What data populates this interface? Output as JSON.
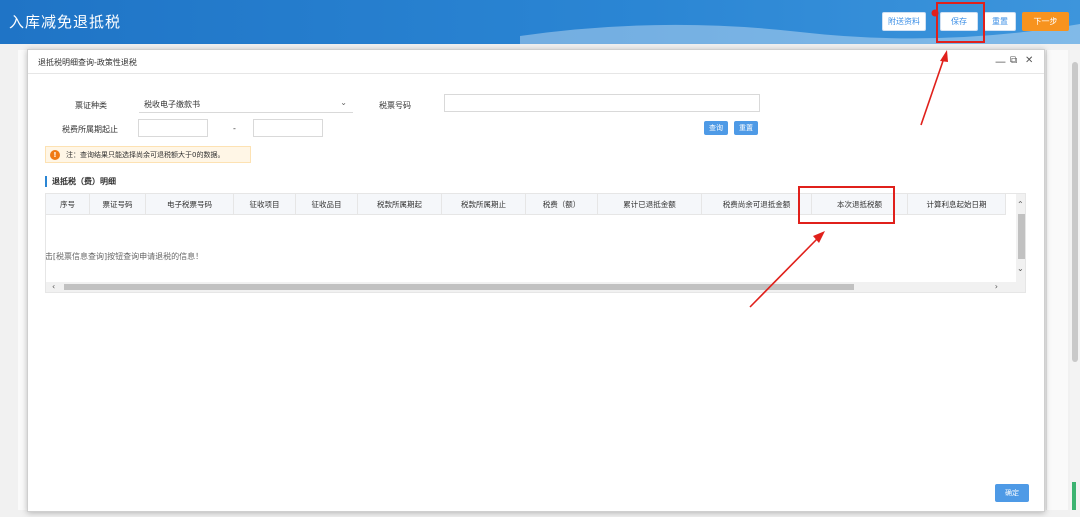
{
  "header": {
    "title": "入库减免退抵税",
    "attach_label": "附送资料",
    "save_label": "保存",
    "reset_label": "重置",
    "next_label": "下一步"
  },
  "modal": {
    "title": "退抵税明细查询-政策性退税",
    "controls": {
      "minimize": "—",
      "restore": "⧉",
      "close": "✕"
    },
    "form": {
      "ticket_type_label": "票证种类",
      "ticket_type_value": "税收电子缴款书",
      "tax_ticket_no_label": "税票号码",
      "tax_ticket_no_value": "",
      "period_start_label": "税费所属期起止",
      "period_start_value": "",
      "period_sep": "-",
      "period_end_value": "",
      "query_label": "查询",
      "reset_label": "重置"
    },
    "notice": {
      "icon": "!",
      "text": "注：查询结果只能选择尚余可退税额大于0的数据。"
    },
    "section_title": "退抵税（费）明细",
    "table": {
      "columns": [
        "序号",
        "票证号码",
        "电子税票号码",
        "征收项目",
        "征收品目",
        "税款所属期起",
        "税款所属期止",
        "税费（额）",
        "累计已退抵金额",
        "税费尚余可退抵金额",
        "本次退抵税额",
        "计算利息起始日期"
      ],
      "empty_text": "暂无数据，请点击[税票信息查询]按钮查询申请退税的信息！"
    },
    "confirm_label": "确定"
  },
  "colors": {
    "header_blue": "#2b86d4",
    "next_orange": "#f7931e",
    "annotation_red": "#e0201b",
    "button_blue": "#4e9ae6"
  }
}
